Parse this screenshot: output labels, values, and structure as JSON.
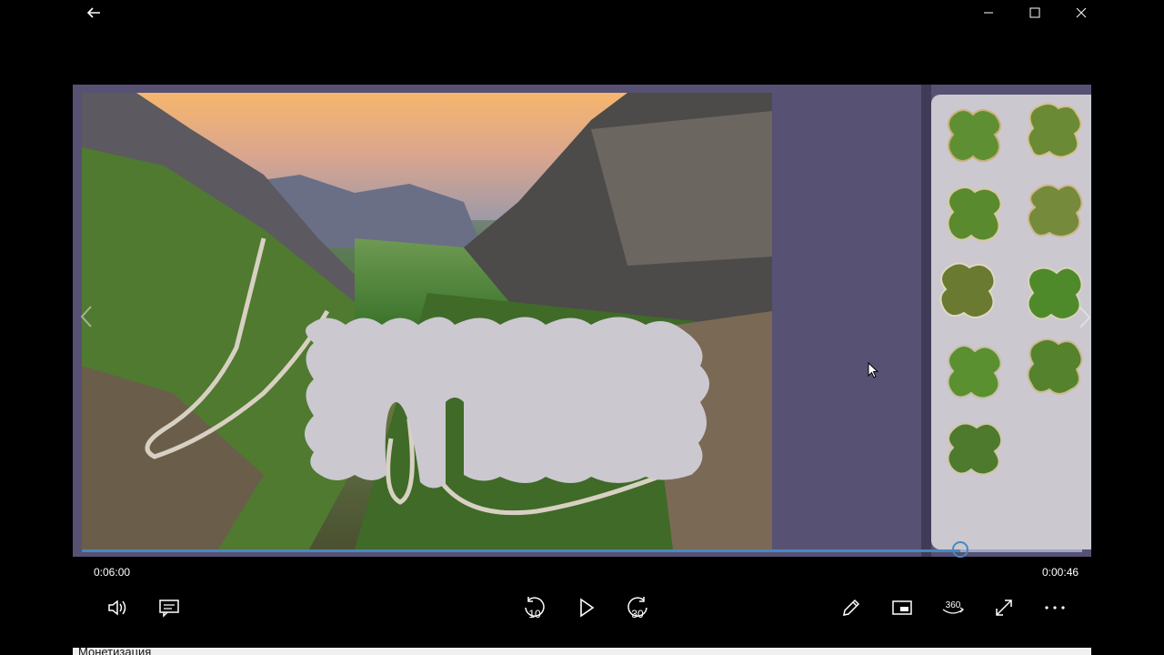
{
  "titlebar": {
    "back_icon": "back-arrow-icon",
    "minimize_icon": "minimize-icon",
    "maximize_icon": "maximize-icon",
    "close_icon": "close-icon"
  },
  "player": {
    "current_time": "0:06:00",
    "remaining_time": "0:00:46",
    "progress_fraction": 0.878
  },
  "controls": {
    "left": [
      "volume-icon",
      "subtitles-icon"
    ],
    "center": [
      "rewind-10-icon",
      "play-icon",
      "forward-30-icon"
    ],
    "right": [
      "edit-pencil-icon",
      "mini-view-icon",
      "360-view-icon",
      "fullscreen-icon",
      "more-icon"
    ],
    "rewind_label": "10",
    "forward_label": "30",
    "view360_label": "360"
  },
  "taskbar_peek": {
    "text": "Монетизация"
  },
  "colors": {
    "accent": "#4a87c0",
    "video_bg": "#575173",
    "tray_bg": "#cbc8d0"
  }
}
